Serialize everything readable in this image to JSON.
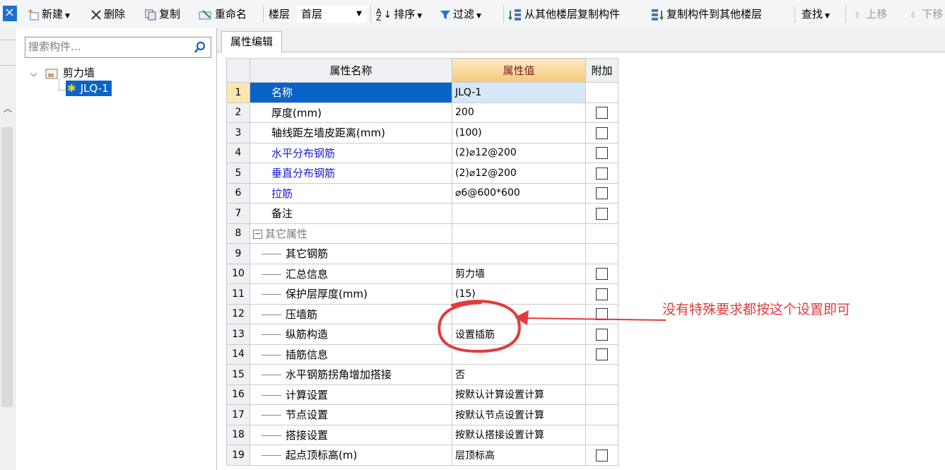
{
  "toolbar": {
    "new_label": "新建",
    "delete_label": "删除",
    "copy_label": "复制",
    "rename_label": "重命名",
    "floor_label": "楼层",
    "floor_value": "首层",
    "sort_label": "排序",
    "filter_label": "过滤",
    "copy_from_floor_label": "从其他楼层复制构件",
    "copy_to_floor_label": "复制构件到其他楼层",
    "find_label": "查找",
    "move_up_label": "上移",
    "move_down_label": "下移"
  },
  "search": {
    "placeholder": "搜索构件..."
  },
  "tree": {
    "root_label": "剪力墙",
    "child_label": "JLQ-1"
  },
  "tab": {
    "label": "属性编辑"
  },
  "grid": {
    "headers": {
      "name": "属性名称",
      "value": "属性值",
      "extra": "附加"
    },
    "rows": [
      {
        "num": "1",
        "name": "名称",
        "value": "JLQ-1"
      },
      {
        "num": "2",
        "name": "厚度(mm)",
        "value": "200"
      },
      {
        "num": "3",
        "name": "轴线距左墙皮距离(mm)",
        "value": "(100)"
      },
      {
        "num": "4",
        "name": "水平分布钢筋",
        "value": "(2)⌀12@200"
      },
      {
        "num": "5",
        "name": "垂直分布钢筋",
        "value": "(2)⌀12@200"
      },
      {
        "num": "6",
        "name": "拉筋",
        "value": "⌀6@600*600"
      },
      {
        "num": "7",
        "name": "备注",
        "value": ""
      },
      {
        "num": "8",
        "name": "其它属性",
        "value": ""
      },
      {
        "num": "9",
        "name": "其它钢筋",
        "value": ""
      },
      {
        "num": "10",
        "name": "汇总信息",
        "value": "剪力墙"
      },
      {
        "num": "11",
        "name": "保护层厚度(mm)",
        "value": "(15)"
      },
      {
        "num": "12",
        "name": "压墙筋",
        "value": ""
      },
      {
        "num": "13",
        "name": "纵筋构造",
        "value": "设置插筋"
      },
      {
        "num": "14",
        "name": "插筋信息",
        "value": ""
      },
      {
        "num": "15",
        "name": "水平钢筋拐角增加搭接",
        "value": "否"
      },
      {
        "num": "16",
        "name": "计算设置",
        "value": "按默认计算设置计算"
      },
      {
        "num": "17",
        "name": "节点设置",
        "value": "按默认节点设置计算"
      },
      {
        "num": "18",
        "name": "搭接设置",
        "value": "按默认搭接设置计算"
      },
      {
        "num": "19",
        "name": "起点顶标高(m)",
        "value": "层顶标高"
      }
    ]
  },
  "annotation": {
    "text": "没有特殊要求都按这个设置即可",
    "color": "#e23b3b"
  },
  "colors": {
    "selection_blue": "#0a64c8",
    "rebar_blue_text": "#1a1ad6",
    "value_header": "#f7c97a"
  }
}
